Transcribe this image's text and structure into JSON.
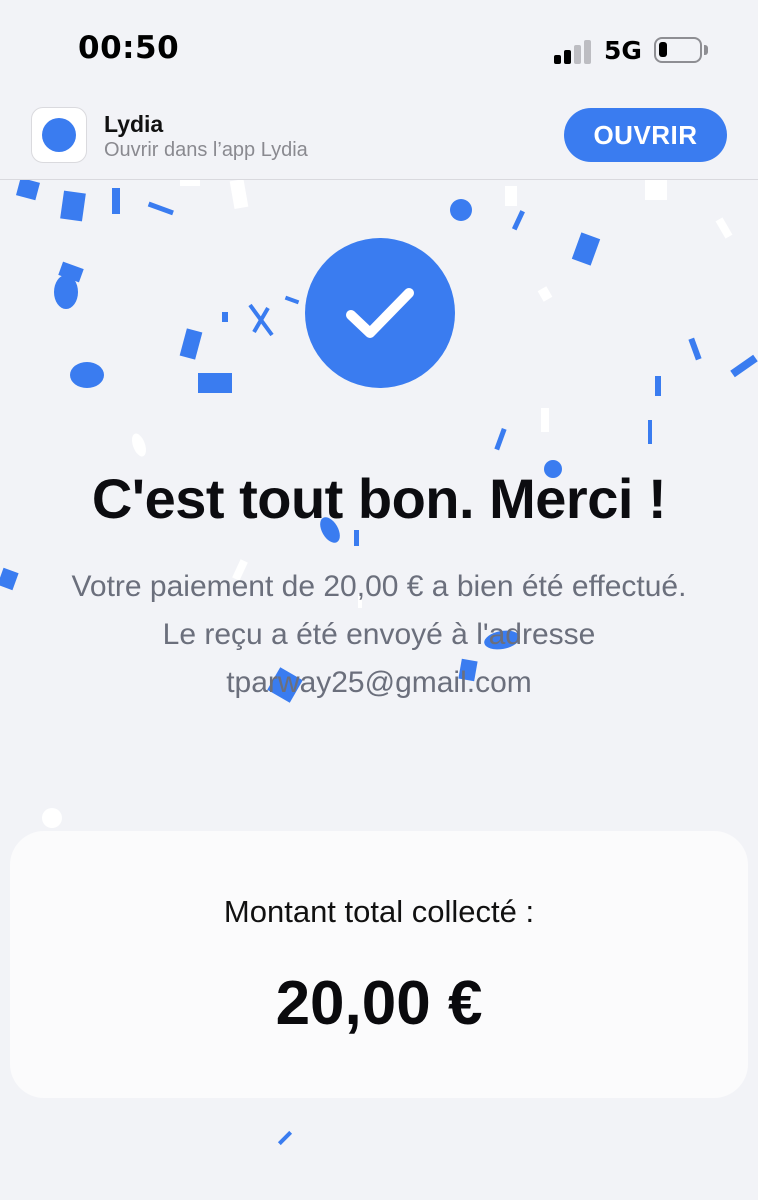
{
  "status_bar": {
    "time": "00:50",
    "network": "5G",
    "signal_bars_active": 2,
    "signal_bars_total": 4,
    "battery_level": 0.2
  },
  "app_banner": {
    "app_name": "Lydia",
    "subtitle": "Ouvrir dans l’app Lydia",
    "open_button": "OUVRIR"
  },
  "success": {
    "icon": "checkmark-icon",
    "title": "C'est tout bon. Merci !",
    "line1": "Votre paiement de 20,00 € a bien été effectué.",
    "line2": "Le reçu a été envoyé à l'adresse",
    "email": "tparway25@gmail.com"
  },
  "summary": {
    "label": "Montant total collecté :",
    "amount": "20,00 €"
  },
  "colors": {
    "accent": "#3a7cf0",
    "background": "#f2f3f7",
    "card": "#fbfbfc",
    "muted_text": "#6b6f7c"
  }
}
